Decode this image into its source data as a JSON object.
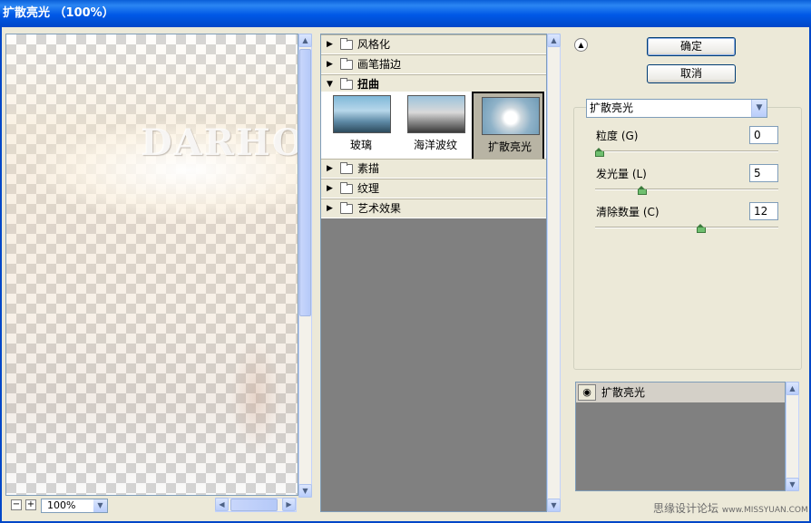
{
  "window": {
    "title": "扩散亮光 （100%）"
  },
  "preview": {
    "watermark_text": "DARHOS"
  },
  "zoom": {
    "minus": "−",
    "plus": "+",
    "value": "100%"
  },
  "gallery": {
    "categories": [
      {
        "label": "风格化",
        "expanded": false
      },
      {
        "label": "画笔描边",
        "expanded": false
      },
      {
        "label": "扭曲",
        "expanded": true
      },
      {
        "label": "素描",
        "expanded": false
      },
      {
        "label": "纹理",
        "expanded": false
      },
      {
        "label": "艺术效果",
        "expanded": false
      }
    ],
    "filters": [
      {
        "label": "玻璃",
        "selected": false
      },
      {
        "label": "海洋波纹",
        "selected": false
      },
      {
        "label": "扩散亮光",
        "selected": true
      }
    ]
  },
  "buttons": {
    "ok": "确定",
    "cancel": "取消"
  },
  "filter_select": {
    "value": "扩散亮光"
  },
  "params": [
    {
      "label": "粒度 (G)",
      "value": "0",
      "level": 0,
      "max": 10
    },
    {
      "label": "发光量 (L)",
      "value": "5",
      "level": 5,
      "max": 20
    },
    {
      "label": "清除数量 (C)",
      "value": "12",
      "level": 12,
      "max": 20
    }
  ],
  "layers": {
    "item": "扩散亮光"
  },
  "watermark": {
    "cn": "思缘设计论坛",
    "en": "www.MISSYUAN.COM"
  },
  "colors": {
    "titlebar": "#0058e6",
    "panel_bg": "#ece9d8",
    "knob": "#6fbf6f"
  }
}
